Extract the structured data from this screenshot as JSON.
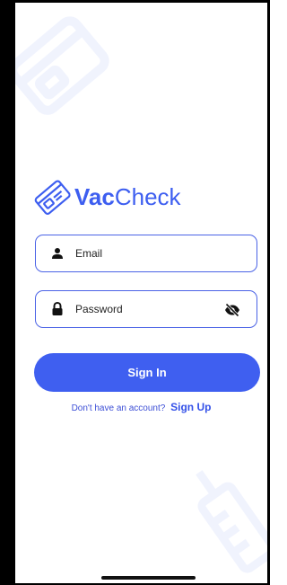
{
  "app": {
    "name_bold": "Vac",
    "name_light": "Check"
  },
  "email": {
    "placeholder": "Email",
    "value": ""
  },
  "password": {
    "placeholder": "Password",
    "value": ""
  },
  "signin": {
    "label": "Sign In"
  },
  "signup": {
    "prompt": "Don't have an account?",
    "link": "Sign Up"
  },
  "icons": {
    "logo": "vaccine-card-icon",
    "email": "user-icon",
    "password": "lock-icon",
    "toggle": "eye-off-icon"
  },
  "colors": {
    "primary": "#3f5ff0",
    "border": "#4b63e6",
    "frame": "#000000"
  }
}
